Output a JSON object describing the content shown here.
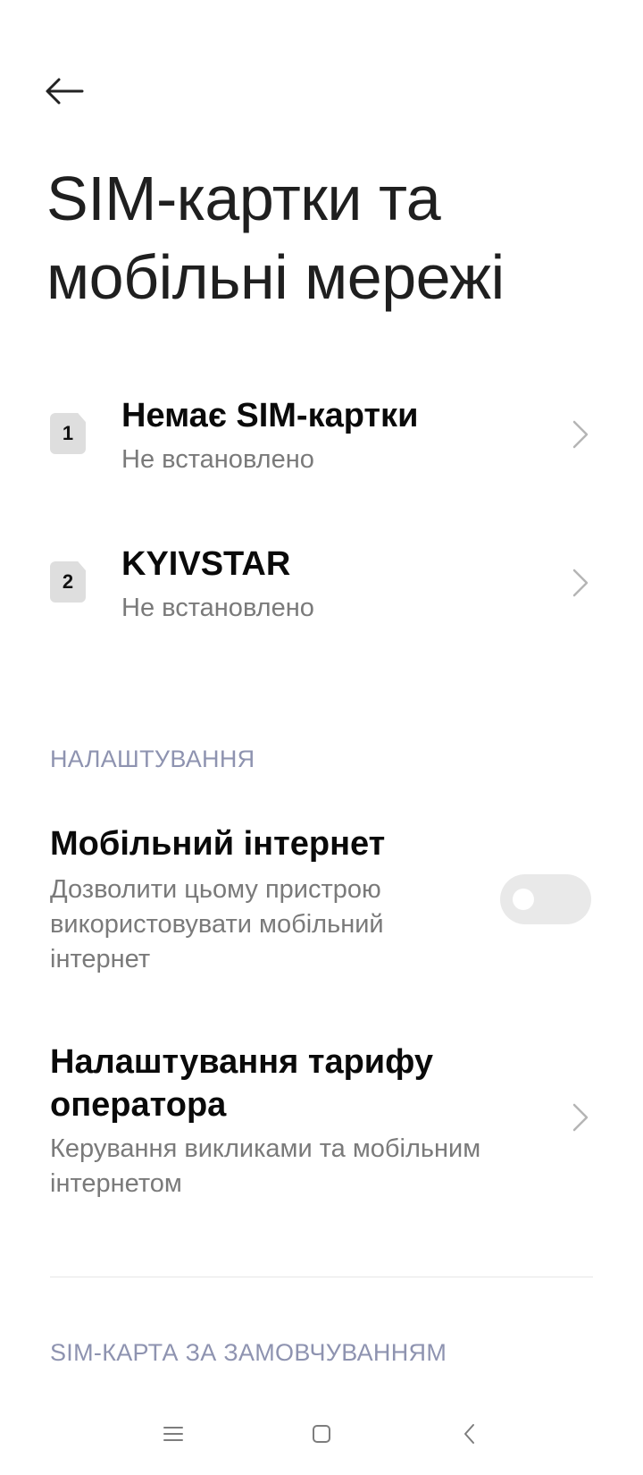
{
  "header": {
    "back_icon": "arrow-left-icon",
    "title_line1": "SIM-картки та",
    "title_line2": "мобільні мережі"
  },
  "sims": [
    {
      "slot": "1",
      "name": "Немає SIM-картки",
      "status": "Не встановлено"
    },
    {
      "slot": "2",
      "name": "KYIVSTAR",
      "status": "Не встановлено"
    }
  ],
  "settings_section": {
    "header": "НАЛАШТУВАННЯ",
    "mobile_internet": {
      "title": "Мобільний інтернет",
      "description": "Дозволити цьому пристрою використовувати мобільний інтернет",
      "enabled": false
    },
    "tariff": {
      "title": "Налаштування тарифу оператора",
      "description": "Керування викликами та мобільним інтернетом"
    }
  },
  "default_sim_section": {
    "header": "SIM-КАРТА ЗА ЗАМОВЧУВАННЯМ"
  },
  "navbar": {
    "menu_icon": "menu-icon",
    "home_icon": "home-icon",
    "back_icon": "back-chevron-icon"
  },
  "colors": {
    "section_header": "#8e93b0",
    "subtitle": "#7a7a7a",
    "toggle_track": "#e9e9e9",
    "sim_badge": "#dedede"
  }
}
